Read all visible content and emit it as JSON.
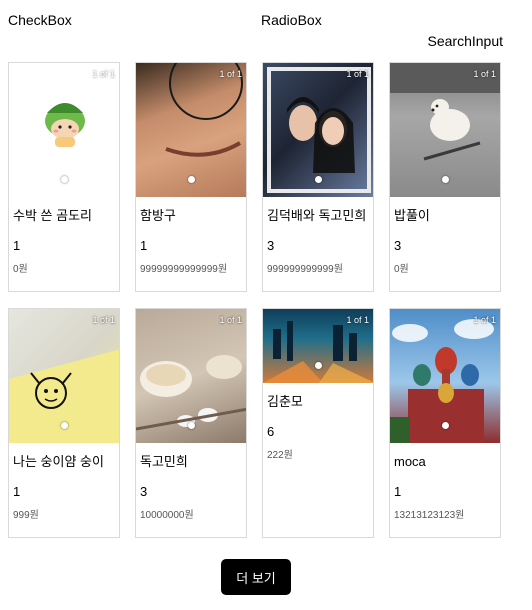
{
  "filters": {
    "checkbox_label": "CheckBox",
    "radio_label": "RadioBox",
    "search_label": "SearchInput"
  },
  "products": [
    {
      "title": "수박 쓴 곰도리",
      "quantity": "1",
      "price": "0원",
      "counter": "1 of 1",
      "image": "watermelon-bear-sticker"
    },
    {
      "title": "함방구",
      "quantity": "1",
      "price": "99999999999999원",
      "counter": "1 of 1",
      "image": "face-closeup-photo"
    },
    {
      "title": "김덕배와 독고민희",
      "quantity": "3",
      "price": "999999999999원",
      "counter": "1 of 1",
      "image": "couple-photo"
    },
    {
      "title": "밥풀이",
      "quantity": "3",
      "price": "0원",
      "counter": "1 of 1",
      "image": "white-dog-photo"
    },
    {
      "title": "나는 숭이얌 숭이",
      "quantity": "1",
      "price": "999원",
      "counter": "1 of 1",
      "image": "drawing-on-paper-photo"
    },
    {
      "title": "독고민희",
      "quantity": "3",
      "price": "10000000원",
      "counter": "1 of 1",
      "image": "dessert-cup-photo"
    },
    {
      "title": "김춘모",
      "quantity": "6",
      "price": "222원",
      "counter": "1 of 1",
      "image": "city-night-photo"
    },
    {
      "title": "moca",
      "quantity": "1",
      "price": "13213123123원",
      "counter": "1 of 1",
      "image": "cathedral-photo"
    }
  ],
  "more_button_label": "더 보기"
}
